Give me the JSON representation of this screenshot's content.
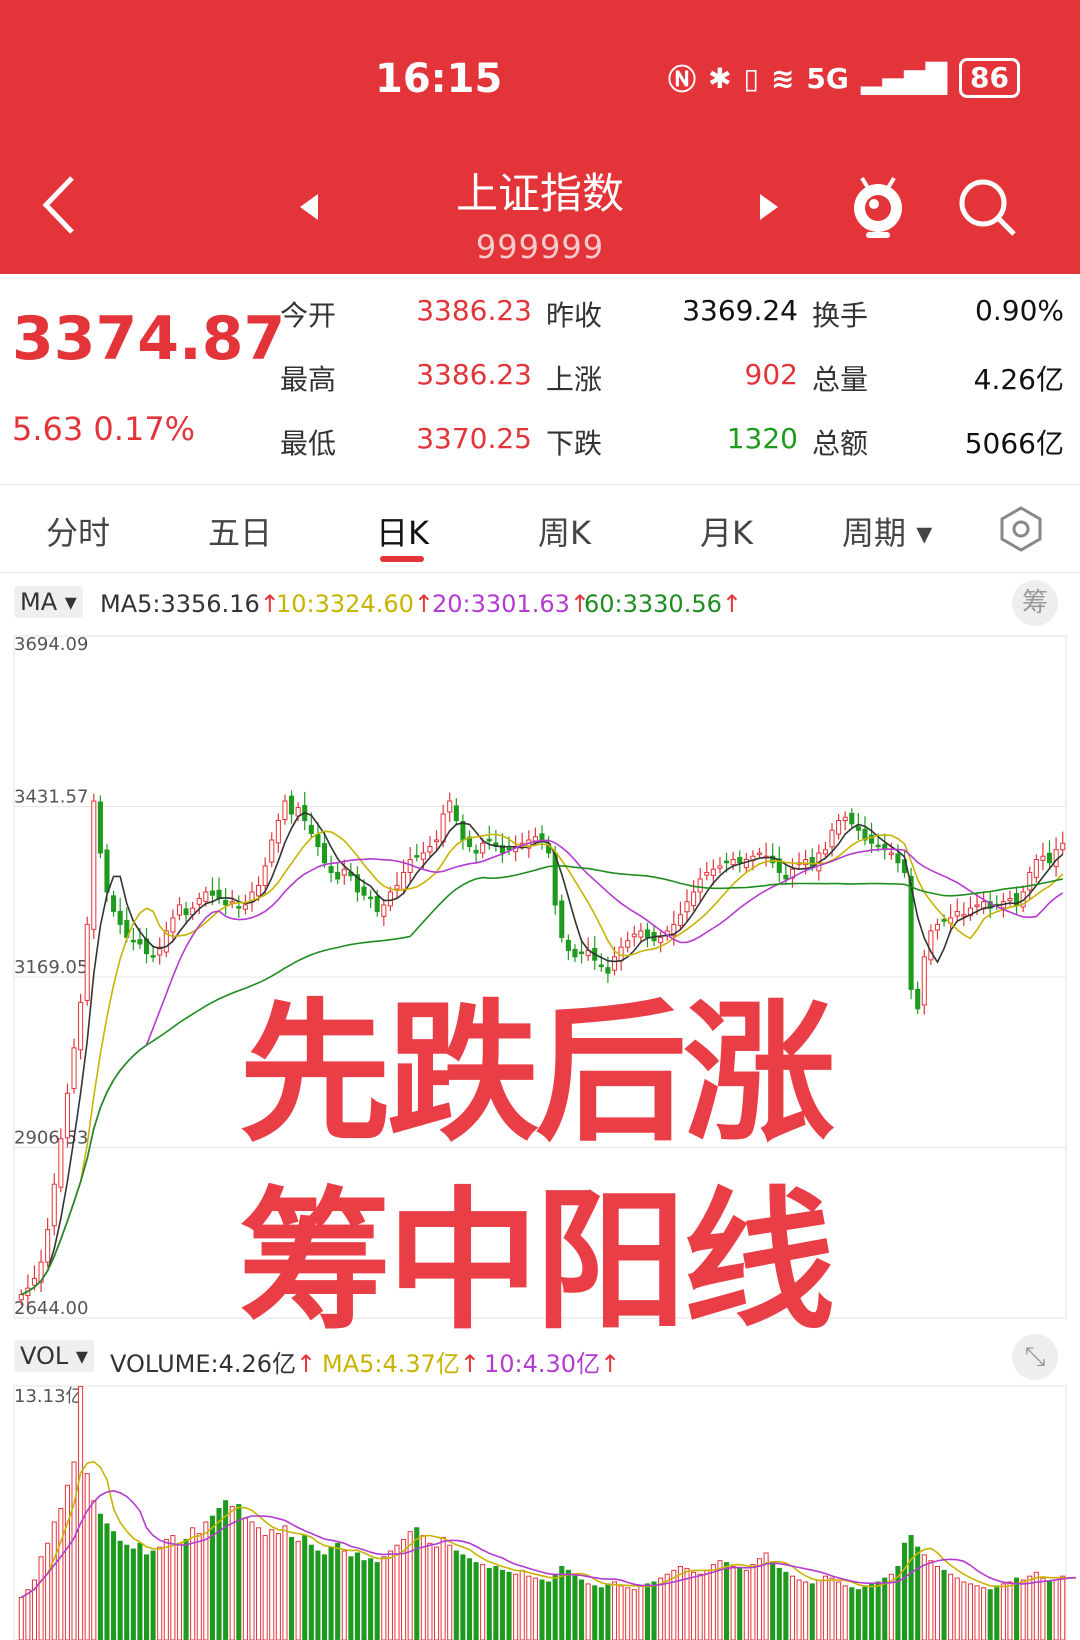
{
  "status_bar": {
    "time": "16:15",
    "network": "5G",
    "battery": "86"
  },
  "header": {
    "title": "上证指数",
    "code": "999999"
  },
  "quote": {
    "price": "3374.87",
    "change": "5.63",
    "change_pct": "0.17%",
    "fields": [
      {
        "label": "今开",
        "value": "3386.23",
        "color": "#E3343A"
      },
      {
        "label": "昨收",
        "value": "3369.24",
        "color": "#111111"
      },
      {
        "label": "换手",
        "value": "0.90%",
        "color": "#111111"
      },
      {
        "label": "最高",
        "value": "3386.23",
        "color": "#E3343A"
      },
      {
        "label": "上涨",
        "value": "902",
        "color": "#E3343A"
      },
      {
        "label": "总量",
        "value": "4.26亿",
        "color": "#111111"
      },
      {
        "label": "最低",
        "value": "3370.25",
        "color": "#E3343A"
      },
      {
        "label": "下跌",
        "value": "1320",
        "color": "#1E9B1E"
      },
      {
        "label": "总额",
        "value": "5066亿",
        "color": "#111111"
      }
    ]
  },
  "tabs": [
    "分时",
    "五日",
    "日K",
    "周K",
    "月K",
    "周期"
  ],
  "active_tab": 2,
  "ma_bar": {
    "chip": "MA",
    "items": [
      {
        "text": "MA5:3356.16",
        "color": "#333333"
      },
      {
        "text": "10:3324.60",
        "color": "#C8B400"
      },
      {
        "text": "20:3301.63",
        "color": "#B43BD0"
      },
      {
        "text": "60:3330.56",
        "color": "#1E8C1E"
      }
    ],
    "chip_button": "筹"
  },
  "vol_bar": {
    "chip": "VOL",
    "items": [
      {
        "text": "VOLUME:4.26亿",
        "color": "#333333"
      },
      {
        "text": "MA5:4.37亿",
        "color": "#C8B400"
      },
      {
        "text": "10:4.30亿",
        "color": "#B43BD0"
      }
    ]
  },
  "overlay": {
    "line1": "先跌后涨",
    "line2": "筹中阳线"
  },
  "chart_data": {
    "type": "candlestick",
    "y_ticks": [
      "3694.09",
      "3431.57",
      "3169.05",
      "2906.53",
      "2644.00"
    ],
    "ylim": [
      2644.0,
      3694.09
    ],
    "vol_max_label": "13.13亿",
    "vol_ylim": [
      0,
      13.13
    ],
    "close": [
      2680,
      2690,
      2705,
      2730,
      2780,
      2850,
      2920,
      2990,
      3060,
      3130,
      3250,
      3440,
      3360,
      3300,
      3270,
      3250,
      3230,
      3225,
      3220,
      3205,
      3200,
      3215,
      3240,
      3260,
      3280,
      3265,
      3275,
      3290,
      3300,
      3295,
      3290,
      3280,
      3285,
      3275,
      3280,
      3300,
      3310,
      3340,
      3380,
      3410,
      3440,
      3420,
      3430,
      3410,
      3390,
      3370,
      3345,
      3330,
      3320,
      3335,
      3325,
      3300,
      3295,
      3290,
      3270,
      3280,
      3300,
      3310,
      3330,
      3350,
      3355,
      3360,
      3370,
      3380,
      3420,
      3440,
      3410,
      3380,
      3370,
      3360,
      3375,
      3380,
      3370,
      3360,
      3365,
      3370,
      3375,
      3380,
      3385,
      3380,
      3360,
      3280,
      3230,
      3210,
      3200,
      3205,
      3210,
      3195,
      3185,
      3175,
      3200,
      3215,
      3225,
      3235,
      3240,
      3230,
      3225,
      3230,
      3240,
      3250,
      3265,
      3285,
      3300,
      3320,
      3330,
      3335,
      3340,
      3345,
      3350,
      3345,
      3350,
      3355,
      3360,
      3355,
      3345,
      3330,
      3320,
      3335,
      3345,
      3350,
      3340,
      3360,
      3365,
      3395,
      3410,
      3415,
      3405,
      3395,
      3380,
      3375,
      3370,
      3365,
      3360,
      3345,
      3330,
      3150,
      3120,
      3200,
      3240,
      3250,
      3255,
      3260,
      3270,
      3265,
      3275,
      3280,
      3285,
      3275,
      3280,
      3285,
      3290,
      3280,
      3300,
      3330,
      3350,
      3355,
      3345,
      3365,
      3375
    ],
    "volume": [
      2.2,
      2.6,
      3.1,
      4.3,
      5.0,
      6.1,
      6.8,
      8.0,
      9.2,
      13.1,
      8.6,
      7.2,
      6.5,
      6.0,
      5.6,
      5.1,
      4.9,
      4.7,
      5.0,
      4.4,
      4.6,
      4.8,
      5.2,
      5.4,
      5.0,
      5.2,
      5.8,
      5.5,
      6.1,
      6.4,
      6.8,
      7.2,
      6.9,
      7.0,
      6.3,
      6.1,
      5.8,
      5.4,
      5.7,
      5.5,
      5.9,
      5.3,
      5.1,
      5.4,
      4.9,
      4.6,
      4.4,
      4.8,
      5.0,
      4.6,
      4.3,
      4.5,
      4.1,
      4.2,
      4.0,
      4.3,
      4.6,
      4.9,
      5.2,
      5.6,
      5.8,
      5.4,
      5.0,
      4.8,
      5.3,
      4.9,
      4.6,
      4.4,
      4.2,
      4.0,
      3.9,
      3.7,
      3.8,
      3.6,
      3.5,
      3.4,
      3.6,
      3.3,
      3.2,
      3.1,
      3.0,
      3.4,
      3.8,
      3.6,
      3.3,
      3.1,
      2.9,
      2.8,
      2.7,
      2.9,
      3.0,
      2.8,
      2.7,
      2.6,
      2.8,
      2.9,
      3.0,
      3.2,
      3.4,
      3.6,
      3.8,
      3.7,
      3.5,
      3.4,
      3.6,
      3.9,
      4.1,
      4.0,
      3.8,
      3.7,
      3.6,
      3.9,
      4.2,
      4.5,
      4.0,
      3.7,
      3.5,
      3.3,
      3.1,
      3.0,
      2.9,
      3.1,
      3.3,
      3.2,
      3.0,
      2.8,
      2.7,
      2.6,
      2.8,
      2.9,
      3.0,
      3.2,
      3.4,
      3.8,
      5.0,
      5.4,
      4.8,
      4.4,
      4.1,
      3.8,
      3.6,
      3.4,
      3.2,
      3.0,
      2.9,
      2.8,
      2.7,
      2.6,
      2.8,
      2.9,
      3.0,
      3.2,
      3.1,
      3.3,
      3.5,
      3.2,
      3.0,
      3.1,
      3.3,
      3.4,
      3.2
    ]
  }
}
